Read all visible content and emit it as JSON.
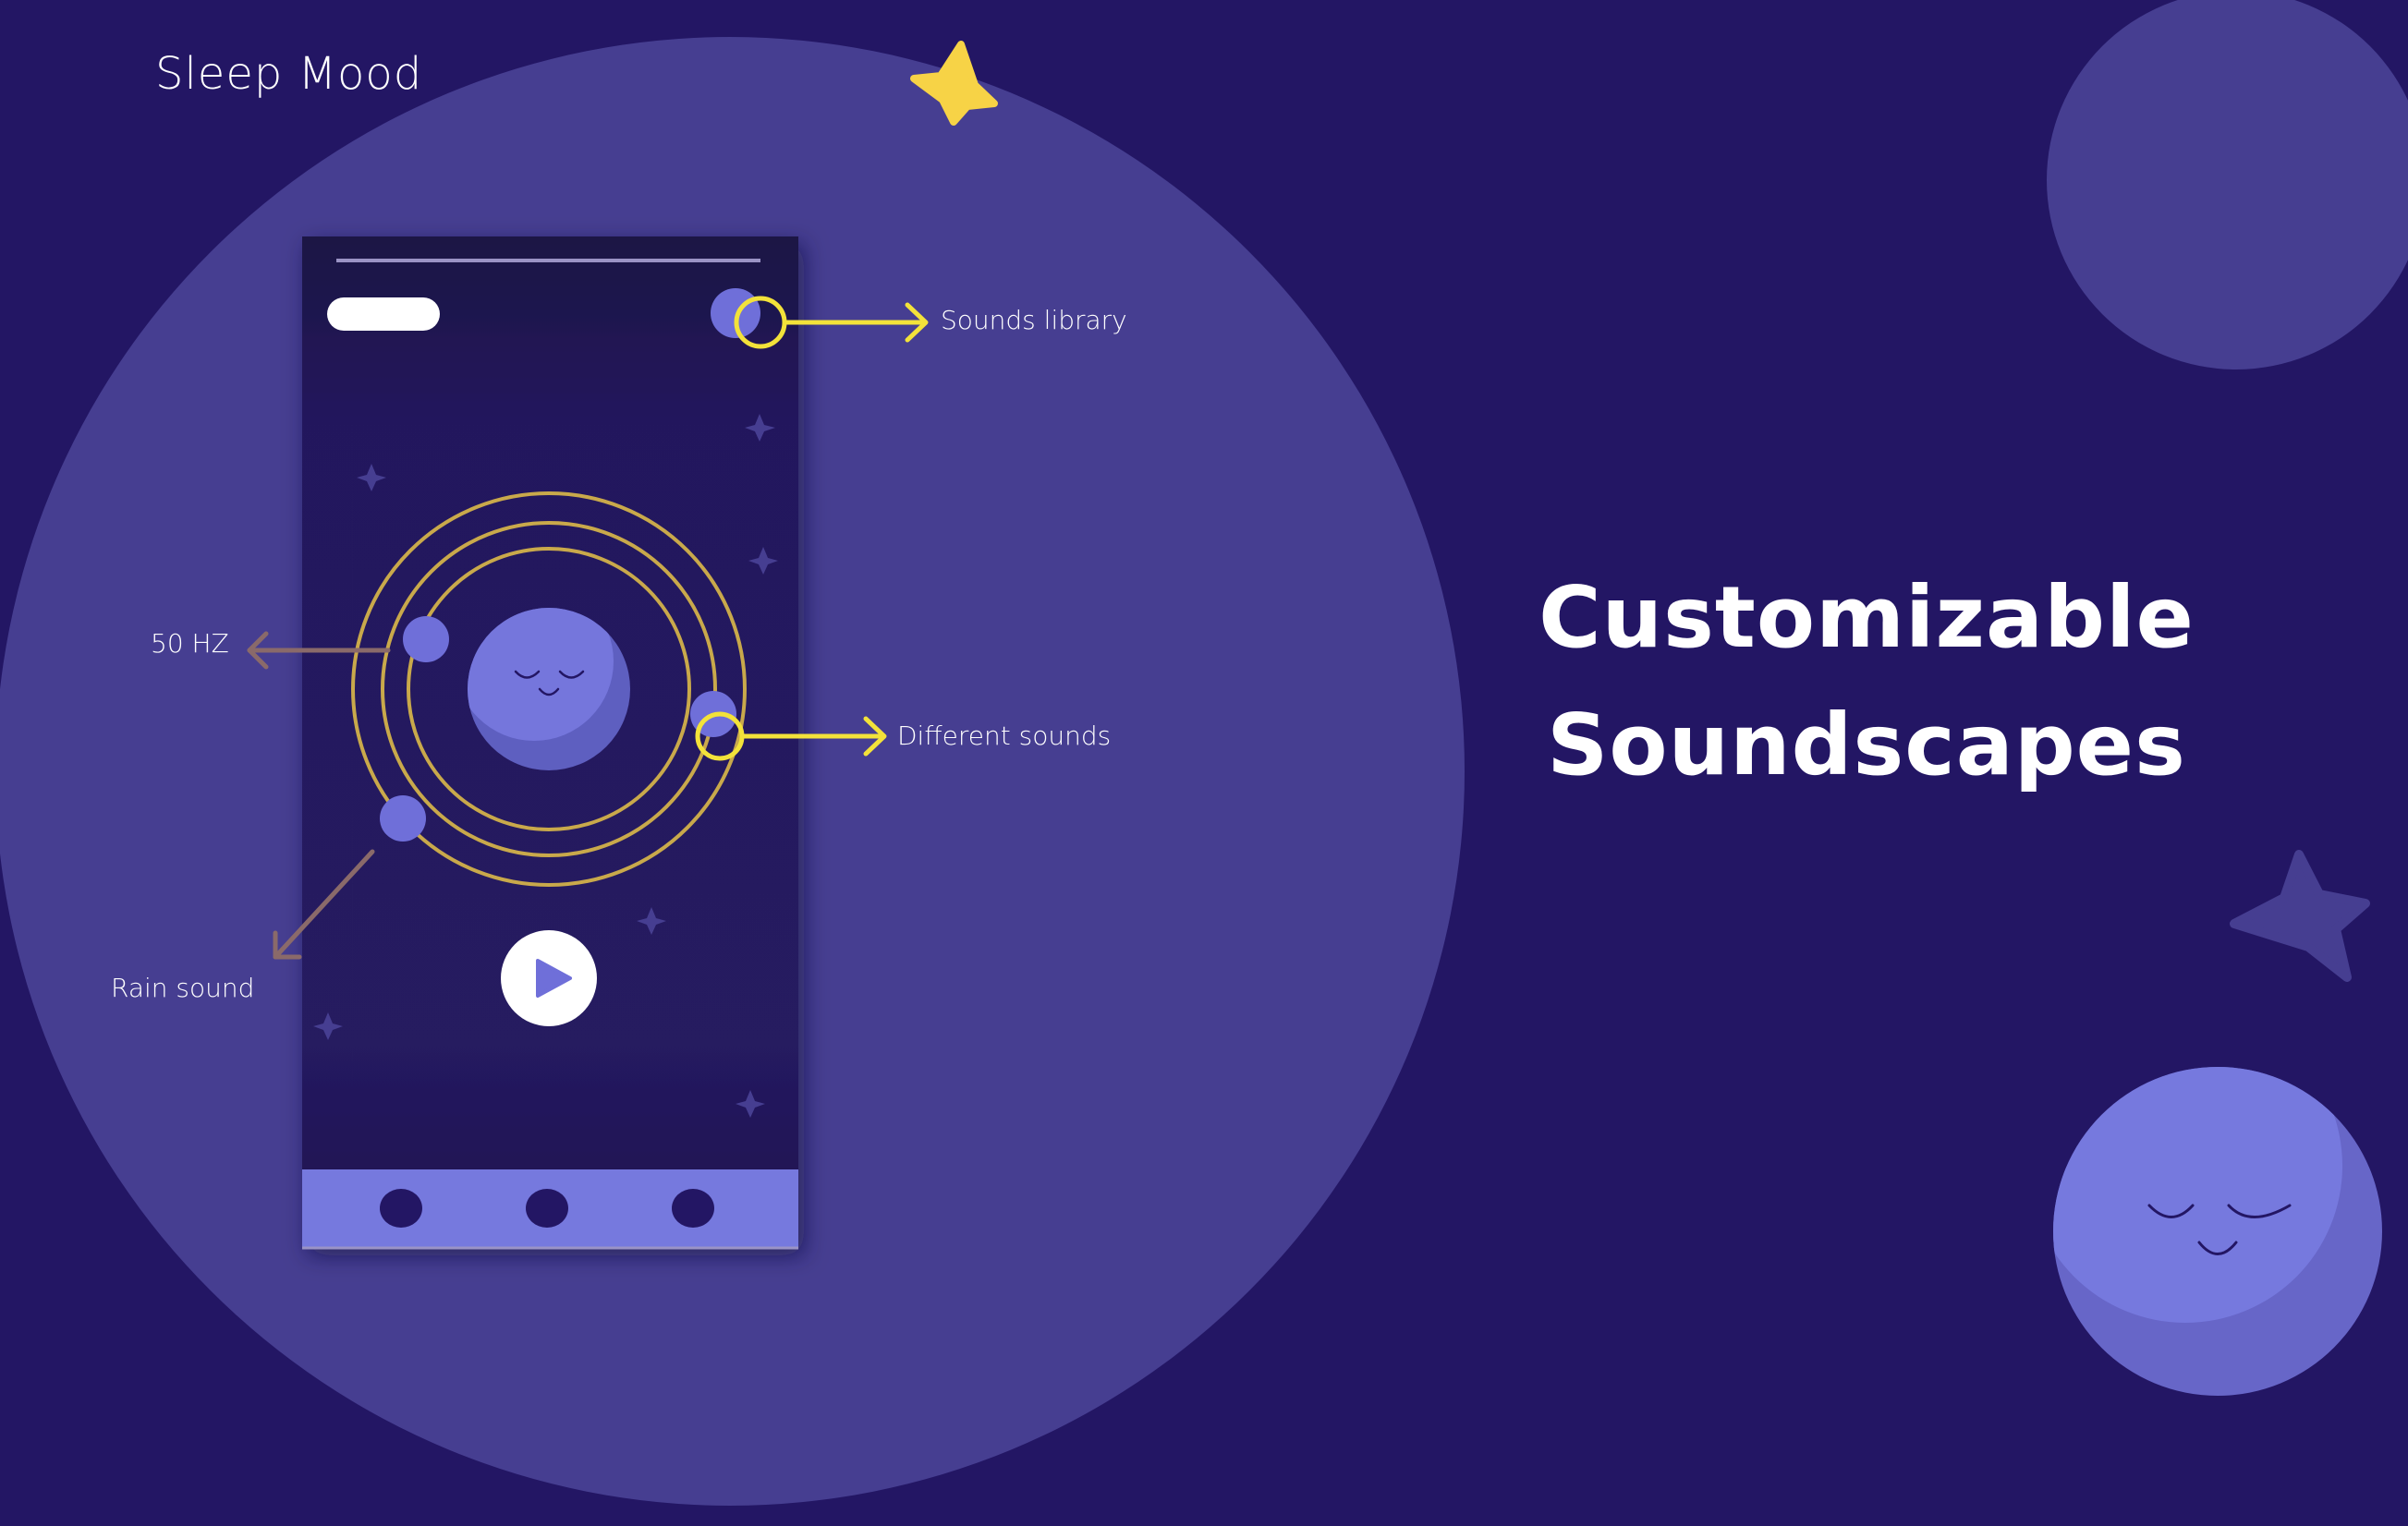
{
  "brand": {
    "name": "Sleep Mood"
  },
  "headline": {
    "line1": "Customizable",
    "line2": "Soundscapes"
  },
  "annotations": {
    "sounds_library": "Sounds library",
    "different_sounds": "Different sounds",
    "frequency": "50 HZ",
    "rain_sound": "Rain sound"
  },
  "phone": {
    "top_pill_button": "",
    "play_button": "play-icon",
    "bottom_nav": [
      "nav-dot",
      "nav-dot",
      "nav-dot"
    ]
  },
  "colors": {
    "background": "#231664",
    "big_circle": "#463e91",
    "phone_bg": "#24185c",
    "accent_purple": "#6f6fd9",
    "gold_ring": "#c9a94b",
    "highlight_yellow": "#f3e23a",
    "star_yellow": "#f7d346",
    "arrow_brown": "#8a6a6a",
    "white": "#ffffff"
  }
}
